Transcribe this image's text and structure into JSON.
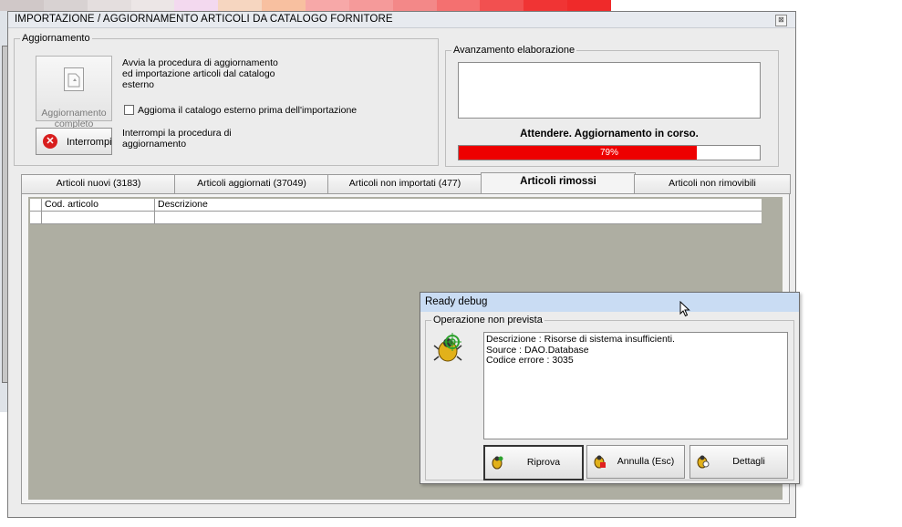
{
  "window": {
    "title": "IMPORTAZIONE / AGGIORNAMENTO ARTICOLI DA CATALOGO FORNITORE",
    "close_glyph": "⊠"
  },
  "aggiornamento": {
    "legend": "Aggiornamento",
    "update_button_line1": "Aggiornamento",
    "update_button_line2": "completo",
    "update_desc_1": "Avvia la procedura di aggiornamento",
    "update_desc_2": "ed importazione articoli dal catalogo",
    "update_desc_3": "esterno",
    "checkbox_label": "Aggioma il catalogo esterno prima dell'importazione",
    "checkbox_checked": false,
    "stop_button": "Interrompi",
    "stop_desc_1": "Interrompi la procedura di",
    "stop_desc_2": "aggiornamento"
  },
  "avanzamento": {
    "legend": "Avanzamento elaborazione",
    "status": "Attendere. Aggiornamento in corso.",
    "progress_label": "79%",
    "progress_fraction": 0.79,
    "progress_color": "#ee0000"
  },
  "tabs": [
    {
      "label": "Articoli nuovi (3183)",
      "active": false
    },
    {
      "label": "Articoli aggiornati (37049)",
      "active": false
    },
    {
      "label": "Articoli non importati (477)",
      "active": false
    },
    {
      "label": "Articoli rimossi",
      "active": true
    },
    {
      "label": "Articoli non rimovibili",
      "active": false
    }
  ],
  "grid": {
    "columns": [
      "Cod. articolo",
      "Descrizione"
    ]
  },
  "debug_dialog": {
    "title": "Ready debug",
    "legend": "Operazione non prevista",
    "line1": "Descrizione : Risorse di sistema insufficienti.",
    "line2": "Source : DAO.Database",
    "line3": "Codice errore : 3035",
    "retry_button": "Riprova",
    "cancel_button": "Annulla (Esc)",
    "details_button": "Dettagli"
  }
}
